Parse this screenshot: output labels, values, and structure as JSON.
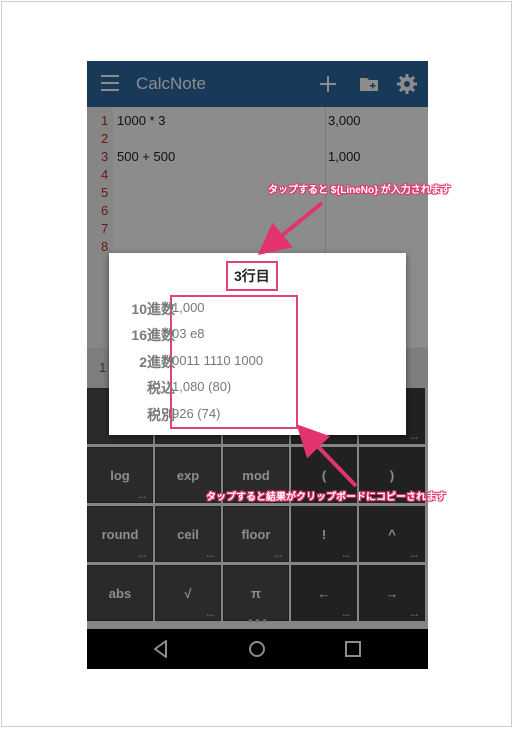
{
  "app": {
    "title": "CalcNote",
    "icons": [
      "menu-icon",
      "add-icon",
      "new-folder-icon",
      "settings-icon"
    ]
  },
  "editor": {
    "line_numbers": [
      "1",
      "2",
      "3",
      "4",
      "5",
      "6",
      "7",
      "8"
    ],
    "lines": [
      {
        "code": "1000 * 3",
        "result": "3,000"
      },
      {
        "code": "",
        "result": ""
      },
      {
        "code": "500 + 500",
        "result": "1,000"
      }
    ]
  },
  "hint_text": "1",
  "keypad": {
    "rows": [
      [
        "log",
        "exp",
        "mod",
        "(",
        ")"
      ],
      [
        "round",
        "ceil",
        "floor",
        "!",
        "^"
      ],
      [
        "abs",
        "√",
        "π",
        "←",
        "→"
      ]
    ]
  },
  "dialog": {
    "title": "3行目",
    "rows": [
      {
        "label": "10進数",
        "value": "1,000"
      },
      {
        "label": "16進数",
        "value": "03 e8"
      },
      {
        "label": "2進数",
        "value": "0011 1110 1000"
      },
      {
        "label": "税込",
        "value": "1,080 (80)"
      },
      {
        "label": "税別",
        "value": "926 (74)"
      }
    ],
    "separator": ":"
  },
  "annotations": {
    "top": "タップすると ${LineNo} が入力されます",
    "bottom": "タップすると結果がクリップボードにコピーされます"
  },
  "colors": {
    "appbar": "#2d6aa1",
    "accent": "#e6407a",
    "line_number": "#c62828",
    "key": "#4d4d4d"
  }
}
